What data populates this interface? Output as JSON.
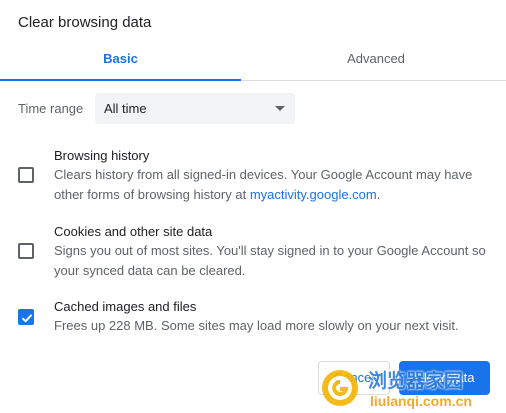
{
  "dialog": {
    "title": "Clear browsing data"
  },
  "tabs": [
    {
      "label": "Basic",
      "active": true
    },
    {
      "label": "Advanced",
      "active": false
    }
  ],
  "time_range": {
    "label": "Time range",
    "selected": "All time"
  },
  "options": [
    {
      "title": "Browsing history",
      "description": "Clears history from all signed-in devices. Your Google Account may have other forms of browsing history at ",
      "link_text": "myactivity.google.com",
      "description_suffix": ".",
      "checked": false
    },
    {
      "title": "Cookies and other site data",
      "description": "Signs you out of most sites. You'll stay signed in to your Google Account so your synced data can be cleared.",
      "checked": false
    },
    {
      "title": "Cached images and files",
      "description": "Frees up 228 MB. Some sites may load more slowly on your next visit.",
      "checked": true
    }
  ],
  "buttons": {
    "cancel": "Cancel",
    "clear": "Clear data"
  },
  "watermark": {
    "text_cn": "浏览器家园",
    "url": "liulanqi.com.cn"
  },
  "colors": {
    "accent": "#1a73e8",
    "text_primary": "#202124",
    "text_secondary": "#5f6368",
    "divider": "#dadce0"
  }
}
